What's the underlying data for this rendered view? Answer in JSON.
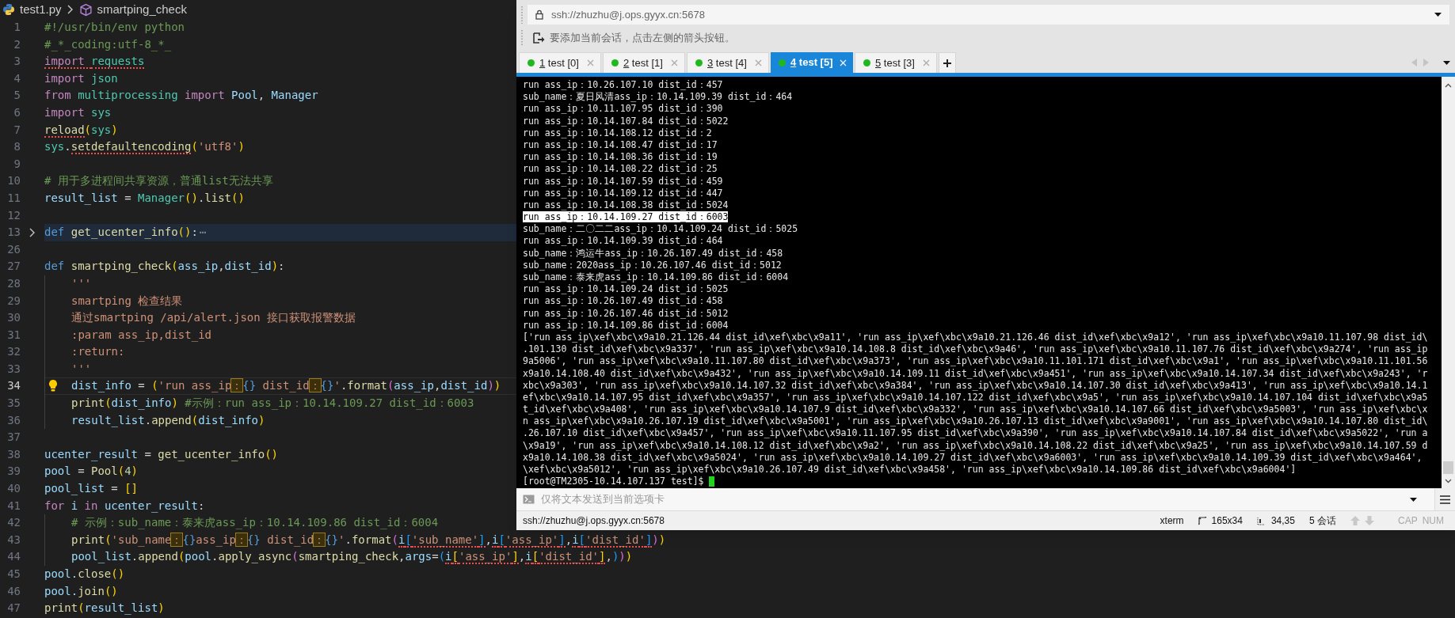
{
  "editor": {
    "breadcrumb": {
      "file": "test1.py",
      "symbol": "smartping_check"
    },
    "lines": [
      {
        "number": "1",
        "folded": false,
        "current": false,
        "indented": false,
        "segments": [
          {
            "text": "#!/usr/bin/env python",
            "kind": "comment",
            "squiggle": false
          }
        ]
      },
      {
        "number": "2",
        "folded": false,
        "current": false,
        "indented": false,
        "segments": [
          {
            "text": "#_*_coding:utf-8_*_",
            "kind": "comment",
            "squiggle": false
          }
        ]
      },
      {
        "number": "3",
        "folded": false,
        "current": false,
        "indented": false,
        "segments": [
          {
            "text": "import ",
            "kind": "control",
            "squiggle": true
          },
          {
            "text": "requests",
            "kind": "module",
            "squiggle": true
          }
        ]
      },
      {
        "number": "4",
        "folded": false,
        "current": false,
        "indented": false,
        "segments": [
          {
            "text": "import ",
            "kind": "control",
            "squiggle": false
          },
          {
            "text": "json",
            "kind": "module",
            "squiggle": false
          }
        ]
      },
      {
        "number": "5",
        "folded": false,
        "current": false,
        "indented": false,
        "segments": [
          {
            "text": "from ",
            "kind": "control",
            "squiggle": false
          },
          {
            "text": "multiprocessing ",
            "kind": "module",
            "squiggle": false
          },
          {
            "text": "import ",
            "kind": "control",
            "squiggle": false
          },
          {
            "text": "Pool",
            "kind": "variable",
            "squiggle": false
          },
          {
            "text": ", ",
            "kind": "plain",
            "squiggle": false
          },
          {
            "text": "Manager",
            "kind": "variable",
            "squiggle": false
          }
        ]
      },
      {
        "number": "6",
        "folded": false,
        "current": false,
        "indented": false,
        "segments": [
          {
            "text": "import ",
            "kind": "control",
            "squiggle": false
          },
          {
            "text": "sys",
            "kind": "module",
            "squiggle": false
          }
        ]
      },
      {
        "number": "7",
        "folded": false,
        "current": false,
        "indented": false,
        "segments": [
          {
            "text": "reload",
            "kind": "function",
            "squiggle": true
          },
          {
            "text": "(",
            "kind": "bracket1",
            "squiggle": false
          },
          {
            "text": "sys",
            "kind": "module",
            "squiggle": false
          },
          {
            "text": ")",
            "kind": "bracket1",
            "squiggle": false
          }
        ]
      },
      {
        "number": "8",
        "folded": false,
        "current": false,
        "indented": false,
        "segments": [
          {
            "text": "sys",
            "kind": "module",
            "squiggle": false
          },
          {
            "text": ".",
            "kind": "plain",
            "squiggle": false
          },
          {
            "text": "setdefaultencoding",
            "kind": "function",
            "squiggle": true
          },
          {
            "text": "(",
            "kind": "bracket1",
            "squiggle": false
          },
          {
            "text": "'utf8'",
            "kind": "string",
            "squiggle": false
          },
          {
            "text": ")",
            "kind": "bracket1",
            "squiggle": false
          }
        ]
      },
      {
        "number": "9",
        "folded": false,
        "current": false,
        "indented": false
      },
      {
        "number": "10",
        "folded": false,
        "current": false,
        "indented": false,
        "segments": [
          {
            "text": "# 用于多进程间共享资源，普通list无法共享",
            "kind": "comment",
            "squiggle": false
          }
        ]
      },
      {
        "number": "11",
        "folded": false,
        "current": false,
        "indented": false,
        "segments": [
          {
            "text": "result_list",
            "kind": "variable",
            "squiggle": false
          },
          {
            "text": " = ",
            "kind": "plain",
            "squiggle": false
          },
          {
            "text": "Manager",
            "kind": "class",
            "squiggle": false
          },
          {
            "text": "()",
            "kind": "bracket1",
            "squiggle": false
          },
          {
            "text": ".",
            "kind": "plain",
            "squiggle": false
          },
          {
            "text": "list",
            "kind": "function",
            "squiggle": false
          },
          {
            "text": "()",
            "kind": "bracket1",
            "squiggle": false
          }
        ]
      },
      {
        "number": "12",
        "folded": false,
        "current": false,
        "indented": false
      },
      {
        "number": "13",
        "folded": true,
        "current": false,
        "indented": false,
        "segments": [
          {
            "text": "def ",
            "kind": "storage",
            "squiggle": false
          },
          {
            "text": "get_ucenter_info",
            "kind": "function",
            "squiggle": false
          },
          {
            "text": "()",
            "kind": "bracket1",
            "squiggle": false
          },
          {
            "text": ":",
            "kind": "plain",
            "squiggle": false
          },
          {
            "text": "⋯",
            "kind": "ellipsis",
            "squiggle": false
          }
        ]
      },
      {
        "number": "26",
        "folded": false,
        "current": false,
        "indented": false
      },
      {
        "number": "27",
        "folded": false,
        "current": false,
        "indented": false,
        "segments": [
          {
            "text": "def ",
            "kind": "storage",
            "squiggle": false
          },
          {
            "text": "smartping_check",
            "kind": "function",
            "squiggle": false
          },
          {
            "text": "(",
            "kind": "bracket1",
            "squiggle": false
          },
          {
            "text": "ass_ip",
            "kind": "variable",
            "squiggle": false
          },
          {
            "text": ",",
            "kind": "plain",
            "squiggle": false
          },
          {
            "text": "dist_id",
            "kind": "variable",
            "squiggle": false
          },
          {
            "text": ")",
            "kind": "bracket1",
            "squiggle": false
          },
          {
            "text": ":",
            "kind": "plain",
            "squiggle": false
          }
        ]
      },
      {
        "number": "28",
        "folded": false,
        "current": false,
        "indented": true,
        "segments": [
          {
            "text": "'''",
            "kind": "string",
            "squiggle": false
          }
        ]
      },
      {
        "number": "29",
        "folded": false,
        "current": false,
        "indented": true,
        "segments": [
          {
            "text": "smartping 检查结果",
            "kind": "string",
            "squiggle": false
          }
        ]
      },
      {
        "number": "30",
        "folded": false,
        "current": false,
        "indented": true,
        "segments": [
          {
            "text": "通过smartping /api/alert.json 接口获取报警数据",
            "kind": "string",
            "squiggle": false
          }
        ]
      },
      {
        "number": "31",
        "folded": false,
        "current": false,
        "indented": true,
        "segments": [
          {
            "text": ":param ass_ip,dist_id",
            "kind": "string",
            "squiggle": false
          }
        ]
      },
      {
        "number": "32",
        "folded": false,
        "current": false,
        "indented": true,
        "segments": [
          {
            "text": ":return:",
            "kind": "string",
            "squiggle": false
          }
        ]
      },
      {
        "number": "33",
        "folded": false,
        "current": false,
        "indented": true,
        "segments": [
          {
            "text": "'''",
            "kind": "string",
            "squiggle": false
          }
        ]
      },
      {
        "number": "34",
        "folded": false,
        "current": true,
        "indented": true,
        "segments": [
          {
            "text": "dist_info",
            "kind": "variable",
            "squiggle": false
          },
          {
            "text": " = ",
            "kind": "plain",
            "squiggle": false
          },
          {
            "text": "(",
            "kind": "bracket1",
            "squiggle": false
          },
          {
            "text": "'run ass_ip",
            "kind": "string",
            "squiggle": false
          },
          {
            "text": "：",
            "kind": "boxed",
            "squiggle": false
          },
          {
            "text": "{}",
            "kind": "placeholder",
            "squiggle": false
          },
          {
            "text": " dist_id",
            "kind": "string",
            "squiggle": false
          },
          {
            "text": "：",
            "kind": "boxed",
            "squiggle": false
          },
          {
            "text": "{}",
            "kind": "placeholder",
            "squiggle": false
          },
          {
            "text": "'",
            "kind": "string",
            "squiggle": false
          },
          {
            "text": ".",
            "kind": "plain",
            "squiggle": false
          },
          {
            "text": "format",
            "kind": "function",
            "squiggle": false
          },
          {
            "text": "(",
            "kind": "bracket2",
            "squiggle": false
          },
          {
            "text": "ass_ip",
            "kind": "variable",
            "squiggle": false
          },
          {
            "text": ",",
            "kind": "plain",
            "squiggle": false
          },
          {
            "text": "dist_id",
            "kind": "variable",
            "squiggle": false
          },
          {
            "text": ")",
            "kind": "bracket2",
            "squiggle": false
          },
          {
            "text": ")",
            "kind": "bracket1",
            "squiggle": false
          }
        ]
      },
      {
        "number": "35",
        "folded": false,
        "current": false,
        "indented": true,
        "segments": [
          {
            "text": "print",
            "kind": "function",
            "squiggle": false
          },
          {
            "text": "(",
            "kind": "bracket1",
            "squiggle": false
          },
          {
            "text": "dist_info",
            "kind": "variable",
            "squiggle": false
          },
          {
            "text": ") ",
            "kind": "bracket1",
            "squiggle": false
          },
          {
            "text": "#示例：run ass_ip：10.14.109.27 dist_id：6003",
            "kind": "comment",
            "squiggle": false
          }
        ]
      },
      {
        "number": "36",
        "folded": false,
        "current": false,
        "indented": true,
        "segments": [
          {
            "text": "result_list",
            "kind": "variable",
            "squiggle": false
          },
          {
            "text": ".",
            "kind": "plain",
            "squiggle": false
          },
          {
            "text": "append",
            "kind": "function",
            "squiggle": false
          },
          {
            "text": "(",
            "kind": "bracket1",
            "squiggle": false
          },
          {
            "text": "dist_info",
            "kind": "variable",
            "squiggle": false
          },
          {
            "text": ")",
            "kind": "bracket1",
            "squiggle": false
          }
        ]
      },
      {
        "number": "37",
        "folded": false,
        "current": false,
        "indented": false
      },
      {
        "number": "38",
        "folded": false,
        "current": false,
        "indented": false,
        "segments": [
          {
            "text": "ucenter_result",
            "kind": "variable",
            "squiggle": false
          },
          {
            "text": " = ",
            "kind": "plain",
            "squiggle": false
          },
          {
            "text": "get_ucenter_info",
            "kind": "function",
            "squiggle": false
          },
          {
            "text": "()",
            "kind": "bracket1",
            "squiggle": false
          }
        ]
      },
      {
        "number": "39",
        "folded": false,
        "current": false,
        "indented": false,
        "segments": [
          {
            "text": "pool",
            "kind": "variable",
            "squiggle": false
          },
          {
            "text": " = ",
            "kind": "plain",
            "squiggle": false
          },
          {
            "text": "Pool",
            "kind": "function",
            "squiggle": false
          },
          {
            "text": "(",
            "kind": "bracket1",
            "squiggle": false
          },
          {
            "text": "4",
            "kind": "number",
            "squiggle": false
          },
          {
            "text": ")",
            "kind": "bracket1",
            "squiggle": false
          }
        ]
      },
      {
        "number": "40",
        "folded": false,
        "current": false,
        "indented": false,
        "segments": [
          {
            "text": "pool_list",
            "kind": "variable",
            "squiggle": false
          },
          {
            "text": " = ",
            "kind": "plain",
            "squiggle": false
          },
          {
            "text": "[]",
            "kind": "bracket1",
            "squiggle": false
          }
        ]
      },
      {
        "number": "41",
        "folded": false,
        "current": false,
        "indented": false,
        "segments": [
          {
            "text": "for ",
            "kind": "control",
            "squiggle": false
          },
          {
            "text": "i ",
            "kind": "variable",
            "squiggle": false
          },
          {
            "text": "in ",
            "kind": "control",
            "squiggle": false
          },
          {
            "text": "ucenter_result",
            "kind": "variable",
            "squiggle": false
          },
          {
            "text": ":",
            "kind": "plain",
            "squiggle": false
          }
        ]
      },
      {
        "number": "42",
        "folded": false,
        "current": false,
        "indented": true,
        "segments": [
          {
            "text": "# 示例：sub_name：泰来虎ass_ip：10.14.109.86 dist_id：6004",
            "kind": "comment",
            "squiggle": false
          }
        ]
      },
      {
        "number": "43",
        "folded": false,
        "current": false,
        "indented": true,
        "segments": [
          {
            "text": "print",
            "kind": "function",
            "squiggle": false
          },
          {
            "text": "(",
            "kind": "bracket1",
            "squiggle": false
          },
          {
            "text": "'sub_name",
            "kind": "string",
            "squiggle": false
          },
          {
            "text": "：",
            "kind": "boxed",
            "squiggle": false
          },
          {
            "text": "{}",
            "kind": "placeholder",
            "squiggle": false
          },
          {
            "text": "ass_ip",
            "kind": "string",
            "squiggle": false
          },
          {
            "text": "：",
            "kind": "boxed",
            "squiggle": false
          },
          {
            "text": "{}",
            "kind": "placeholder",
            "squiggle": false
          },
          {
            "text": " dist_id",
            "kind": "string",
            "squiggle": false
          },
          {
            "text": "：",
            "kind": "boxed",
            "squiggle": false
          },
          {
            "text": "{}",
            "kind": "placeholder",
            "squiggle": false
          },
          {
            "text": "'",
            "kind": "string",
            "squiggle": false
          },
          {
            "text": ".",
            "kind": "plain",
            "squiggle": false
          },
          {
            "text": "format",
            "kind": "function",
            "squiggle": false
          },
          {
            "text": "(",
            "kind": "bracket2",
            "squiggle": false
          },
          {
            "text": "i",
            "kind": "variable",
            "squiggle": true
          },
          {
            "text": "[",
            "kind": "bracket3",
            "squiggle": true
          },
          {
            "text": "'sub_name'",
            "kind": "string",
            "squiggle": true
          },
          {
            "text": "]",
            "kind": "bracket3",
            "squiggle": true
          },
          {
            "text": ",",
            "kind": "plain",
            "squiggle": false
          },
          {
            "text": "i",
            "kind": "variable",
            "squiggle": true
          },
          {
            "text": "[",
            "kind": "bracket3",
            "squiggle": true
          },
          {
            "text": "'ass_ip'",
            "kind": "string",
            "squiggle": true
          },
          {
            "text": "]",
            "kind": "bracket3",
            "squiggle": true
          },
          {
            "text": ",",
            "kind": "plain",
            "squiggle": false
          },
          {
            "text": "i",
            "kind": "variable",
            "squiggle": true
          },
          {
            "text": "[",
            "kind": "bracket3",
            "squiggle": true
          },
          {
            "text": "'dist_id'",
            "kind": "string",
            "squiggle": true
          },
          {
            "text": "]",
            "kind": "bracket3",
            "squiggle": true
          },
          {
            "text": ")",
            "kind": "bracket2",
            "squiggle": false
          },
          {
            "text": ")",
            "kind": "bracket1",
            "squiggle": false
          }
        ]
      },
      {
        "number": "44",
        "folded": false,
        "current": false,
        "indented": true,
        "segments": [
          {
            "text": "pool_list",
            "kind": "variable",
            "squiggle": false
          },
          {
            "text": ".",
            "kind": "plain",
            "squiggle": false
          },
          {
            "text": "append",
            "kind": "function",
            "squiggle": false
          },
          {
            "text": "(",
            "kind": "bracket1",
            "squiggle": false
          },
          {
            "text": "pool",
            "kind": "variable",
            "squiggle": false
          },
          {
            "text": ".",
            "kind": "plain",
            "squiggle": false
          },
          {
            "text": "apply_async",
            "kind": "function",
            "squiggle": false
          },
          {
            "text": "(",
            "kind": "bracket2",
            "squiggle": false
          },
          {
            "text": "smartping_check",
            "kind": "function",
            "squiggle": false
          },
          {
            "text": ",",
            "kind": "plain",
            "squiggle": false
          },
          {
            "text": "args",
            "kind": "variable",
            "squiggle": false
          },
          {
            "text": "=",
            "kind": "plain",
            "squiggle": false
          },
          {
            "text": "(",
            "kind": "bracket3",
            "squiggle": false
          },
          {
            "text": "i",
            "kind": "variable",
            "squiggle": true
          },
          {
            "text": "[",
            "kind": "bracket1",
            "squiggle": true
          },
          {
            "text": "'ass_ip'",
            "kind": "string",
            "squiggle": true
          },
          {
            "text": "]",
            "kind": "bracket1",
            "squiggle": true
          },
          {
            "text": ",",
            "kind": "plain",
            "squiggle": false
          },
          {
            "text": "i",
            "kind": "variable",
            "squiggle": true
          },
          {
            "text": "[",
            "kind": "bracket1",
            "squiggle": true
          },
          {
            "text": "'dist_id'",
            "kind": "string",
            "squiggle": true
          },
          {
            "text": "]",
            "kind": "bracket1",
            "squiggle": true
          },
          {
            "text": ",",
            "kind": "plain",
            "squiggle": false
          },
          {
            "text": ")",
            "kind": "bracket3",
            "squiggle": false
          },
          {
            "text": ")",
            "kind": "bracket2",
            "squiggle": false
          },
          {
            "text": ")",
            "kind": "bracket1",
            "squiggle": false
          }
        ]
      },
      {
        "number": "45",
        "folded": false,
        "current": false,
        "indented": false,
        "segments": [
          {
            "text": "pool.",
            "kind": "variable",
            "squiggle": false
          },
          {
            "text": "close",
            "kind": "function",
            "squiggle": false
          },
          {
            "text": "()",
            "kind": "bracket1",
            "squiggle": false
          }
        ]
      },
      {
        "number": "46",
        "folded": false,
        "current": false,
        "indented": false,
        "segments": [
          {
            "text": "pool.",
            "kind": "variable",
            "squiggle": false
          },
          {
            "text": "join",
            "kind": "function",
            "squiggle": false
          },
          {
            "text": "()",
            "kind": "bracket1",
            "squiggle": false
          }
        ]
      },
      {
        "number": "47",
        "folded": false,
        "current": false,
        "indented": false,
        "segments": [
          {
            "text": "print",
            "kind": "function",
            "squiggle": false
          },
          {
            "text": "(",
            "kind": "bracket1",
            "squiggle": false
          },
          {
            "text": "result_list",
            "kind": "variable",
            "squiggle": false
          },
          {
            "text": ")",
            "kind": "bracket1",
            "squiggle": false
          }
        ]
      }
    ]
  },
  "terminal": {
    "address": "ssh://zhuzhu@j.ops.gyyx.cn:5678",
    "hint": "要添加当前会话，点击左侧的箭头按钮。",
    "tabs": [
      {
        "key": "1",
        "title": "test [0]",
        "selected": false
      },
      {
        "key": "2",
        "title": "test [1]",
        "selected": false
      },
      {
        "key": "3",
        "title": "test [4]",
        "selected": false
      },
      {
        "key": "4",
        "title": "test [5]",
        "selected": true
      },
      {
        "key": "5",
        "title": "test [3]",
        "selected": false
      }
    ],
    "output": [
      {
        "text": "run ass_ip：10.26.107.10 dist_id：457",
        "selected": false
      },
      {
        "text": "sub_name：夏日风清ass_ip：10.14.109.39 dist_id：464",
        "selected": false
      },
      {
        "text": "run ass_ip：10.11.107.95 dist_id：390",
        "selected": false
      },
      {
        "text": "run ass_ip：10.14.107.84 dist_id：5022",
        "selected": false
      },
      {
        "text": "run ass_ip：10.14.108.12 dist_id：2",
        "selected": false
      },
      {
        "text": "run ass_ip：10.14.108.47 dist_id：17",
        "selected": false
      },
      {
        "text": "run ass_ip：10.14.108.36 dist_id：19",
        "selected": false
      },
      {
        "text": "run ass_ip：10.14.108.22 dist_id：25",
        "selected": false
      },
      {
        "text": "run ass_ip：10.14.107.59 dist_id：459",
        "selected": false
      },
      {
        "text": "run ass_ip：10.14.109.12 dist_id：447",
        "selected": false
      },
      {
        "text": "run ass_ip：10.14.108.38 dist_id：5024",
        "selected": false
      },
      {
        "text": "run ass_ip：10.14.109.27 dist_id：6003",
        "selected": true
      },
      {
        "text": "sub_name：二〇二二ass_ip：10.14.109.24 dist_id：5025",
        "selected": false
      },
      {
        "text": "run ass_ip：10.14.109.39 dist_id：464",
        "selected": false
      },
      {
        "text": "sub_name：鸿运牛ass_ip：10.26.107.49 dist_id：458",
        "selected": false
      },
      {
        "text": "sub_name：2020ass_ip：10.26.107.46 dist_id：5012",
        "selected": false
      },
      {
        "text": "sub_name：泰来虎ass_ip：10.14.109.86 dist_id：6004",
        "selected": false
      },
      {
        "text": "run ass_ip：10.14.109.24 dist_id：5025",
        "selected": false
      },
      {
        "text": "run ass_ip：10.26.107.49 dist_id：458",
        "selected": false
      },
      {
        "text": "run ass_ip：10.26.107.46 dist_id：5012",
        "selected": false
      },
      {
        "text": "run ass_ip：10.14.109.86 dist_id：6004",
        "selected": false
      },
      {
        "text": "['run ass_ip\\xef\\xbc\\x9a10.21.126.44 dist_id\\xef\\xbc\\x9a11', 'run ass_ip\\xef\\xbc\\x9a10.21.126.46 dist_id\\xef\\xbc\\x9a12', 'run ass_ip\\xef\\xbc\\x9a10.11.107.98 dist_id\\",
        "selected": false
      },
      {
        "text": ".101.130 dist_id\\xef\\xbc\\x9a337', 'run ass_ip\\xef\\xbc\\x9a10.14.108.8 dist_id\\xef\\xbc\\x9a46', 'run ass_ip\\xef\\xbc\\x9a10.11.107.76 dist_id\\xef\\xbc\\x9a274', 'run ass_ip",
        "selected": false
      },
      {
        "text": "9a5006', 'run ass_ip\\xef\\xbc\\x9a10.11.107.80 dist_id\\xef\\xbc\\x9a373', 'run ass_ip\\xef\\xbc\\x9a10.11.101.171 dist_id\\xef\\xbc\\x9a1', 'run ass_ip\\xef\\xbc\\x9a10.11.101.56",
        "selected": false
      },
      {
        "text": "x9a10.14.108.40 dist_id\\xef\\xbc\\x9a432', 'run ass_ip\\xef\\xbc\\x9a10.14.109.11 dist_id\\xef\\xbc\\x9a451', 'run ass_ip\\xef\\xbc\\x9a10.14.107.34 dist_id\\xef\\xbc\\x9a243', 'r",
        "selected": false
      },
      {
        "text": "xbc\\x9a303', 'run ass_ip\\xef\\xbc\\x9a10.14.107.32 dist_id\\xef\\xbc\\x9a384', 'run ass_ip\\xef\\xbc\\x9a10.14.107.30 dist_id\\xef\\xbc\\x9a413', 'run ass_ip\\xef\\xbc\\x9a10.14.1",
        "selected": false
      },
      {
        "text": "ef\\xbc\\x9a10.14.107.95 dist_id\\xef\\xbc\\x9a357', 'run ass_ip\\xef\\xbc\\x9a10.14.107.122 dist_id\\xef\\xbc\\x9a5', 'run ass_ip\\xef\\xbc\\x9a10.14.107.104 dist_id\\xef\\xbc\\x9a5",
        "selected": false
      },
      {
        "text": "t_id\\xef\\xbc\\x9a408', 'run ass_ip\\xef\\xbc\\x9a10.14.107.9 dist_id\\xef\\xbc\\x9a332', 'run ass_ip\\xef\\xbc\\x9a10.14.107.66 dist_id\\xef\\xbc\\x9a5003', 'run ass_ip\\xef\\xbc\\x",
        "selected": false
      },
      {
        "text": "n ass_ip\\xef\\xbc\\x9a10.26.107.19 dist_id\\xef\\xbc\\x9a5001', 'run ass_ip\\xef\\xbc\\x9a10.26.107.13 dist_id\\xef\\xbc\\x9a9001', 'run ass_ip\\xef\\xbc\\x9a10.14.107.80 dist_id\\",
        "selected": false
      },
      {
        "text": ".26.107.10 dist_id\\xef\\xbc\\x9a457', 'run ass_ip\\xef\\xbc\\x9a10.11.107.95 dist_id\\xef\\xbc\\x9a390', 'run ass_ip\\xef\\xbc\\x9a10.14.107.84 dist_id\\xef\\xbc\\x9a5022', 'run a",
        "selected": false
      },
      {
        "text": "\\x9a19', 'run ass_ip\\xef\\xbc\\x9a10.14.108.12 dist_id\\xef\\xbc\\x9a2', 'run ass_ip\\xef\\xbc\\x9a10.14.108.22 dist_id\\xef\\xbc\\x9a25', 'run ass_ip\\xef\\xbc\\x9a10.14.107.59 d",
        "selected": false
      },
      {
        "text": "x9a10.14.108.38 dist_id\\xef\\xbc\\x9a5024', 'run ass_ip\\xef\\xbc\\x9a10.14.109.27 dist_id\\xef\\xbc\\x9a6003', 'run ass_ip\\xef\\xbc\\x9a10.14.109.39 dist_id\\xef\\xbc\\x9a464',",
        "selected": false
      },
      {
        "text": "\\xef\\xbc\\x9a5012', 'run ass_ip\\xef\\xbc\\x9a10.26.107.49 dist_id\\xef\\xbc\\x9a458', 'run ass_ip\\xef\\xbc\\x9a10.14.109.86 dist_id\\xef\\xbc\\x9a6004']",
        "selected": false
      }
    ],
    "prompt": "[root@TM2305-10.14.107.137 test]$",
    "input_placeholder": "仅将文本发送到当前选项卡",
    "status_bar": {
      "connection": "ssh://zhuzhu@j.ops.gyyx.cn:5678",
      "terminal_type": "xterm",
      "size": "165x34",
      "cursor": "34,35",
      "sessions": "5 会话",
      "indicators": [
        {
          "label": "CAP",
          "on": false
        },
        {
          "label": "NUM",
          "on": false
        }
      ]
    }
  }
}
